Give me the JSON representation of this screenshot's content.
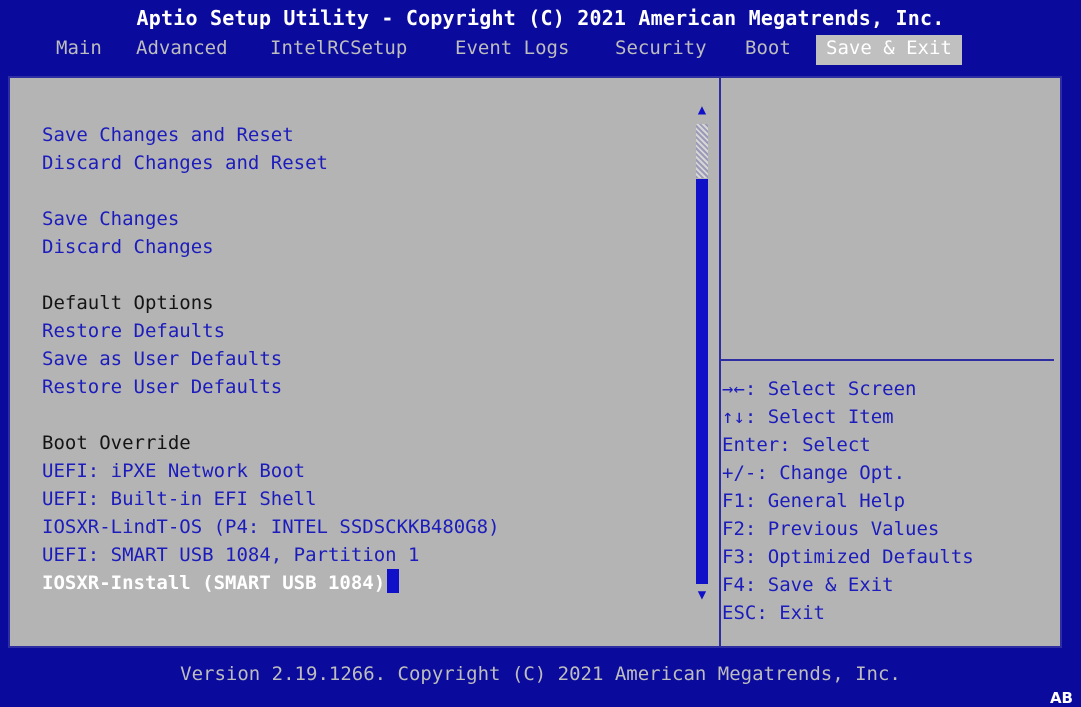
{
  "title": "Aptio Setup Utility - Copyright (C) 2021 American Megatrends, Inc.",
  "tabs": [
    {
      "label": "Main"
    },
    {
      "label": "Advanced"
    },
    {
      "label": "IntelRCSetup"
    },
    {
      "label": "Event Logs"
    },
    {
      "label": "Security"
    },
    {
      "label": "Boot"
    },
    {
      "label": "Save & Exit",
      "active": true
    }
  ],
  "menu": {
    "save_changes_and_reset": "Save Changes and Reset",
    "discard_changes_and_reset": "Discard Changes and Reset",
    "save_changes": "Save Changes",
    "discard_changes": "Discard Changes",
    "default_options_heading": "Default Options",
    "restore_defaults": "Restore Defaults",
    "save_as_user_defaults": "Save as User Defaults",
    "restore_user_defaults": "Restore User Defaults",
    "boot_override_heading": "Boot Override",
    "boot_options": [
      "UEFI: iPXE Network Boot",
      "UEFI: Built-in EFI Shell",
      "IOSXR-LindT-OS (P4: INTEL SSDSCKKB480G8)",
      "UEFI: SMART USB 1084, Partition 1",
      "IOSXR-Install (SMART USB 1084)"
    ],
    "selected_boot_option_index": 4
  },
  "scrollbar": {
    "up_arrow": "▲",
    "down_arrow": "▼"
  },
  "help": [
    "→←: Select Screen",
    "↑↓: Select Item",
    "Enter: Select",
    "+/-: Change Opt.",
    "F1: General Help",
    "F2: Previous Values",
    "F3: Optimized Defaults",
    "F4: Save & Exit",
    "ESC: Exit"
  ],
  "footer": "Version 2.19.1266. Copyright (C) 2021 American Megatrends, Inc.",
  "corner_badge": "AB",
  "colors": {
    "background": "#0a0a9c",
    "panel": "#b4b4b4",
    "item_text": "#1c1cbc",
    "selected_text": "#ffffff",
    "cursor": "#1010c8"
  }
}
